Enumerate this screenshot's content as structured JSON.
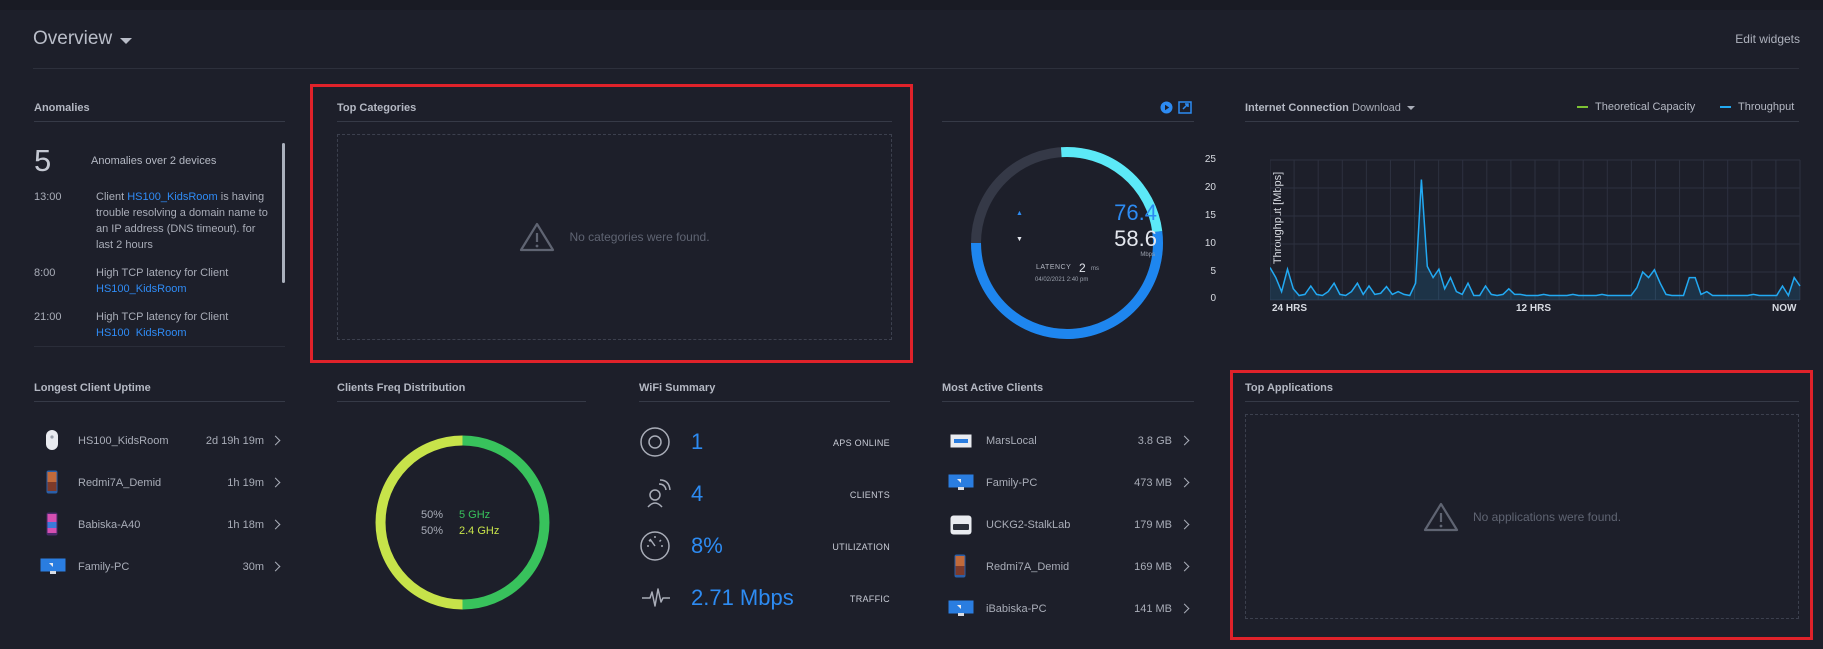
{
  "header": {
    "title": "Overview",
    "edit_widgets": "Edit widgets"
  },
  "anomalies": {
    "title": "Anomalies",
    "count": "5",
    "subtitle": "Anomalies over 2 devices",
    "items": [
      {
        "time": "13:00",
        "pre": "Client ",
        "link": "HS100_KidsRoom",
        "post": " is having trouble resolving a domain name to an IP address (DNS timeout). for last 2 hours"
      },
      {
        "time": "8:00",
        "pre": "High TCP latency for Client ",
        "link": "HS100_KidsRoom",
        "post": ""
      },
      {
        "time": "21:00",
        "pre": "High TCP latency for Client ",
        "link": "HS100_KidsRoom",
        "post": ""
      }
    ]
  },
  "top_categories": {
    "title": "Top Categories",
    "empty": "No categories were found."
  },
  "speedtest": {
    "download": "76.4",
    "upload": "58.6",
    "unit": "Mbps",
    "latency_label": "LATENCY",
    "latency": "2",
    "latency_unit": "ms",
    "date": "04/02/2021 2:40 pm",
    "download_fraction": 0.52,
    "upload_fraction": 0.24,
    "colors": {
      "download": "#1e86ef",
      "upload": "#5ce9f7",
      "track": "#353947"
    }
  },
  "internet": {
    "title": "Internet Connection",
    "mode": "Download",
    "legend": [
      {
        "name": "Theoretical Capacity",
        "color": "#7dc234"
      },
      {
        "name": "Throughput",
        "color": "#22a9f2"
      }
    ]
  },
  "chart_data": {
    "type": "line",
    "ylabel": "Throughput [Mbps]",
    "xlabel": "",
    "ylim": [
      0,
      25
    ],
    "yticks": [
      "25",
      "20",
      "15",
      "10",
      "5",
      "0"
    ],
    "xticks": [
      "24 HRS",
      "12 HRS",
      "NOW"
    ],
    "series": [
      {
        "name": "Throughput",
        "color": "#22a9f2",
        "values": [
          5.8,
          4,
          1.5,
          5.5,
          2,
          0.8,
          1,
          2.5,
          1,
          0.8,
          1.5,
          3,
          1,
          0.8,
          1.5,
          3,
          1,
          2.5,
          1,
          1.2,
          2.4,
          1,
          1.5,
          1,
          0.8,
          3,
          21.5,
          6,
          4,
          5.5,
          2,
          4,
          1.5,
          1,
          3,
          0.8,
          0.8,
          2.5,
          1,
          0.8,
          1,
          2,
          1,
          1,
          0.8,
          0.8,
          0.8,
          1,
          0.8,
          0.8,
          0.8,
          0.8,
          1,
          0.8,
          0.8,
          0.8,
          0.8,
          1,
          0.8,
          0.8,
          0.8,
          0.8,
          0.8,
          2.2,
          5,
          4,
          5.4,
          3,
          1,
          0.8,
          0.8,
          0.8,
          4,
          4,
          1,
          1.5,
          0.8,
          0.8,
          0.8,
          0.8,
          0.8,
          0.8,
          0.8,
          1,
          0.8,
          0.8,
          0.8,
          0.8,
          2.5,
          0.8,
          4,
          2.5
        ]
      }
    ]
  },
  "longest_uptime": {
    "title": "Longest Client Uptime",
    "rows": [
      {
        "name": "HS100_KidsRoom",
        "value": "2d 19h 19m",
        "icon": "smart-plug-icon"
      },
      {
        "name": "Redmi7A_Demid",
        "value": "1h 19m",
        "icon": "phone-icon"
      },
      {
        "name": "Babiska-A40",
        "value": "1h 18m",
        "icon": "phone-icon"
      },
      {
        "name": "Family-PC",
        "value": "30m",
        "icon": "pc-icon"
      }
    ]
  },
  "freq": {
    "title": "Clients Freq Distribution",
    "items": [
      {
        "pct": "50%",
        "band": "5 GHz",
        "color": "#38c25c",
        "fraction": 0.5
      },
      {
        "pct": "50%",
        "band": "2.4 GHz",
        "color": "#c7e34a",
        "fraction": 0.5
      }
    ]
  },
  "wifi": {
    "title": "WiFi Summary",
    "rows": [
      {
        "value": "1",
        "label": "APS ONLINE",
        "icon": "access-point-icon"
      },
      {
        "value": "4",
        "label": "CLIENTS",
        "icon": "clients-icon"
      },
      {
        "value": "8%",
        "label": "UTILIZATION",
        "icon": "gauge-icon"
      },
      {
        "value": "2.71 Mbps",
        "label": "TRAFFIC",
        "icon": "traffic-icon"
      }
    ]
  },
  "most_active": {
    "title": "Most Active Clients",
    "rows": [
      {
        "name": "MarsLocal",
        "value": "3.8 GB",
        "icon": "device-icon"
      },
      {
        "name": "Family-PC",
        "value": "473 MB",
        "icon": "pc-icon"
      },
      {
        "name": "UCKG2-StalkLab",
        "value": "179 MB",
        "icon": "cloud-key-icon"
      },
      {
        "name": "Redmi7A_Demid",
        "value": "169 MB",
        "icon": "phone-icon"
      },
      {
        "name": "iBabiska-PC",
        "value": "141 MB",
        "icon": "pc-icon"
      }
    ]
  },
  "top_apps": {
    "title": "Top Applications",
    "empty": "No applications were found."
  }
}
